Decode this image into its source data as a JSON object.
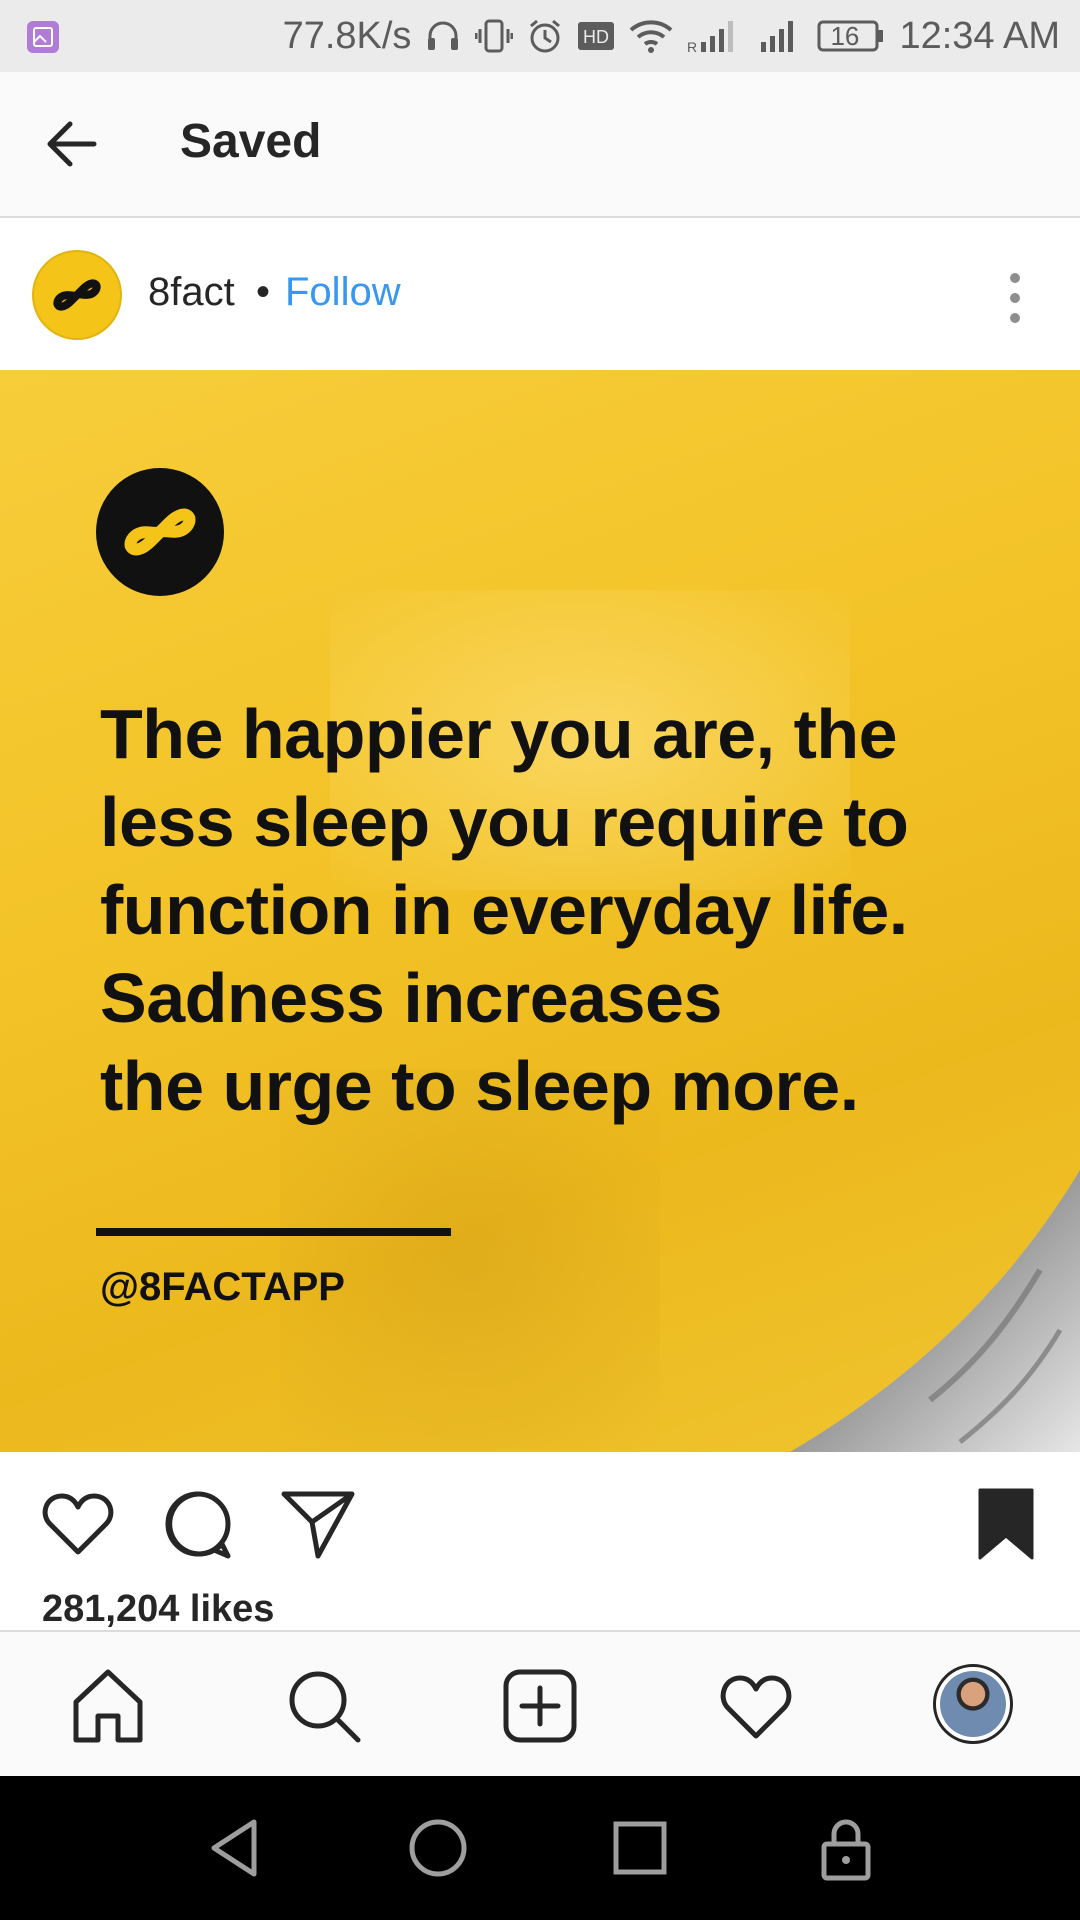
{
  "status_bar": {
    "net_speed": "77.8K/s",
    "battery": "16",
    "time": "12:34 AM",
    "icons": [
      "gallery-icon",
      "headphones-icon",
      "vibrate-icon",
      "alarm-icon",
      "hd-icon",
      "wifi-icon",
      "signal-icon",
      "signal-icon",
      "battery-icon"
    ]
  },
  "app_bar": {
    "title": "Saved",
    "back_icon": "arrow-left-icon"
  },
  "post": {
    "username": "8fact",
    "separator": "•",
    "follow_label": "Follow",
    "more_icon": "more-vertical-icon",
    "image": {
      "fact_lines": [
        "The happier you are, the",
        "less sleep you require to",
        "function in everyday life.",
        "Sadness increases",
        "the urge to sleep more."
      ],
      "handle": "@8FACTAPP"
    },
    "likes": "281,204 likes",
    "actions": [
      "heart-icon",
      "comment-icon",
      "share-icon",
      "bookmark-icon"
    ]
  },
  "bottom_nav": {
    "items": [
      "home-icon",
      "search-icon",
      "add-post-icon",
      "activity-icon",
      "profile-avatar"
    ]
  },
  "colors": {
    "accent_yellow": "#f5c418",
    "follow_blue": "#3897f0",
    "text_dark": "#262626"
  }
}
